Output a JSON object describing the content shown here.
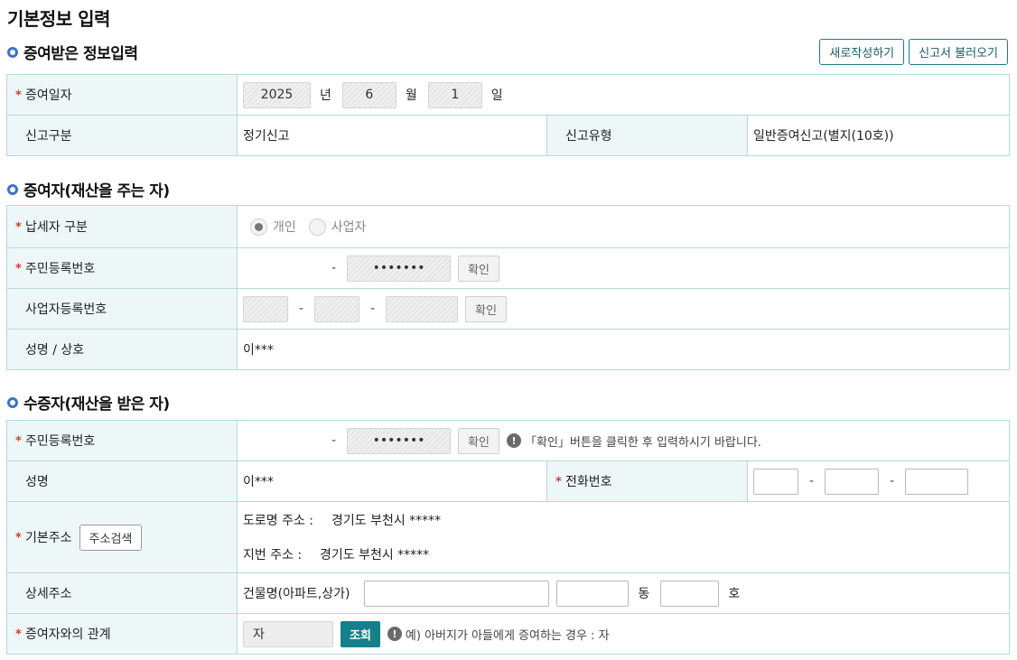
{
  "page_title": "기본정보 입력",
  "sections": {
    "gift_info": "증여받은 정보입력",
    "donor": "증여자(재산을 주는 자)",
    "donee": "수증자(재산을 받은 자)"
  },
  "buttons": {
    "new_write": "새로작성하기",
    "load_report": "신고서 불러오기"
  },
  "gift": {
    "date_label": "증여일자",
    "year": "2025",
    "year_unit": "년",
    "month": "6",
    "month_unit": "월",
    "day": "1",
    "day_unit": "일",
    "report_category_label": "신고구분",
    "report_category_value": "정기신고",
    "report_type_label": "신고유형",
    "report_type_value": "일반증여신고(별지(10호))"
  },
  "donor": {
    "taxpayer_type_label": "납세자 구분",
    "option_individual": "개인",
    "option_business": "사업자",
    "rrn_label": "주민등록번호",
    "rrn_back": "•••••••",
    "confirm": "확인",
    "brn_label": "사업자등록번호",
    "name_label": "성명 / 상호",
    "name_value": "이***"
  },
  "donee": {
    "rrn_label": "주민등록번호",
    "rrn_back": "•••••••",
    "confirm": "확인",
    "hint": "「확인」버튼을 클릭한 후 입력하시기 바랍니다.",
    "name_label": "성명",
    "name_value": "이***",
    "phone_label": "전화번호",
    "address_label": "기본주소",
    "address_search": "주소검색",
    "road_label": "도로명 주소 :",
    "road_value": "경기도 부천시 *****",
    "lot_label": "지번 주소 :",
    "lot_value": "경기도 부천시 *****",
    "detail_label": "상세주소",
    "building_label": "건물명(아파트,상가)",
    "dong_unit": "동",
    "ho_unit": "호",
    "relation_label": "증여자와의 관계",
    "relation_value": "자",
    "lookup": "조회",
    "relation_hint": "예) 아버지가 아들에게 증여하는 경우 : 자"
  },
  "colors": {
    "accent": "#14808a",
    "header_bg": "#eef7f7",
    "border": "#b9d7d8",
    "required": "#dd3333",
    "bullet": "#3f72c9"
  }
}
